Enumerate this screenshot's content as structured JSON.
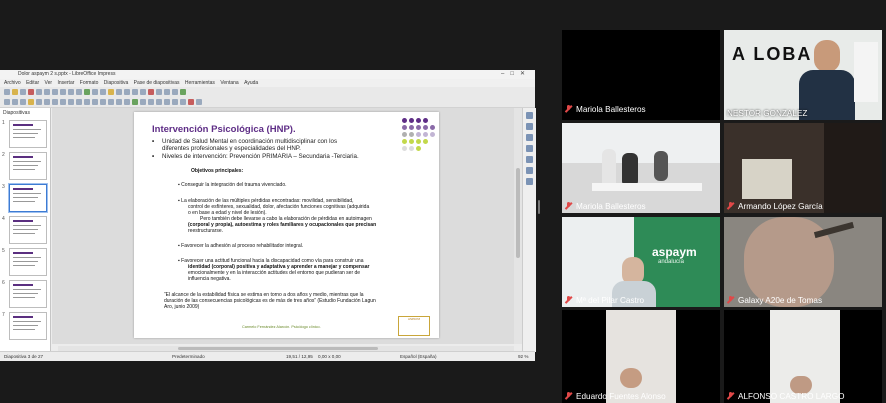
{
  "window": {
    "title": "Dolor aspaym 2 s.pptx - LibreOffice Impress",
    "menu": [
      "Archivo",
      "Editar",
      "Ver",
      "Insertar",
      "Formato",
      "Diapositiva",
      "Pase de diapositivas",
      "Herramientas",
      "Ventana",
      "Ayuda"
    ]
  },
  "panel": {
    "title": "Diapositivas"
  },
  "slide": {
    "title": "Intervención Psicológica (HNP).",
    "bullet1_a": "Unidad de Salud Mental en coordinación multidisciplinar con los",
    "bullet1_b": "diferentes profesionales y especialidades del HNP.",
    "bullet2": "Niveles de intervención: Prevención PRIMARIA – Secundaria -Terciaria.",
    "objetivos": "Objetivos principales:",
    "o1": "Conseguir la integración del trauma vivenciado.",
    "o2_a": "La elaboración de las múltiples pérdidas encontradas: movilidad, sensibilidad,",
    "o2_b": "control de esfínteres, sexualidad, dolor, afectación funciones cognitivas (adquirida",
    "o2_c": "o en base a edad y nivel de lesión).",
    "o2_d": "Pero también debe llevarse a cabo la elaboración de pérdidas en autoimagen",
    "o2_e": "(corporal y propia), autoestima y roles familiares y ocupacionales que precisan",
    "o2_f": "reestructurarse.",
    "o3": "Favorecer la adhesión al proceso rehabilitador integral.",
    "o4_a": "Favorecer una actitud funcional hacia la discapacidad como vía para construir una",
    "o4_b": "identidad (corporal) positiva y adaptativa y aprender a manejar y compensar",
    "o4_c": "emocionalmente y en la interacción actitudes del entorno que pudieran ser de",
    "o4_d": "influencia negativa.",
    "quote_a": "“El alcance de la estabilidad física se estima en torno a dos años y medio, mientras que la",
    "quote_b": "duración de las consecuencias psicológicas es de más de tres años” (Estudio Fundación Lagun",
    "quote_c": "Aro, junio 2009)",
    "footer": "Carmelo Fernández Alarcón. Psicólogo clínico.",
    "logo_text": "ASPAYM"
  },
  "statusbar": {
    "slide_index": "Diapositiva 3 de 27",
    "layout": "Predeterminado",
    "coords": "19,51 / 12,95",
    "size": "0,00 x 0,00",
    "lang": "Español (España)",
    "zoom": "92 %"
  },
  "participants": [
    {
      "name": "",
      "video": "empty"
    },
    {
      "name": "NESTOR GONZALEZ",
      "video": "man-suit"
    },
    {
      "name": "Mariola Ballesteros",
      "video": "empty",
      "muted": true
    },
    {
      "name": "",
      "video": "empty"
    },
    {
      "name": "Mariola Ballesteros",
      "video": "office-group",
      "muted": true
    },
    {
      "name": "Armando López García",
      "video": "room",
      "muted": true
    },
    {
      "name": "Mª del Pilar Castro",
      "video": "woman-banner",
      "muted": true
    },
    {
      "name": "Galaxy A20e de Tomas",
      "video": "ceiling",
      "muted": true
    },
    {
      "name": "Eduardo Fuentes Alonso",
      "video": "man-lowframe",
      "muted": true
    },
    {
      "name": "ALFONSO CASTRO LARGO",
      "video": "man-lowframe2",
      "muted": true
    }
  ],
  "banner": {
    "text1": "aspaym",
    "text2": "andalucía"
  },
  "wall_logo": "A  LOBA",
  "colors": {
    "accent": "#5e2d86",
    "muted_mic": "#e04848",
    "banner_green": "#2e8b57"
  }
}
